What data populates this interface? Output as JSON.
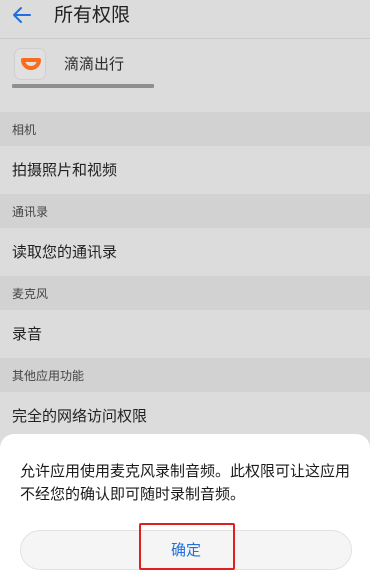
{
  "header": {
    "title": "所有权限",
    "back_icon": "back-arrow-icon"
  },
  "app": {
    "name": "滴滴出行",
    "icon": "didi-logo-icon",
    "icon_color": "#fc6a1b"
  },
  "sections": [
    {
      "heading": "相机",
      "item": "拍摄照片和视频"
    },
    {
      "heading": "通讯录",
      "item": "读取您的通讯录"
    },
    {
      "heading": "麦克风",
      "item": "录音"
    },
    {
      "heading": "其他应用功能",
      "item": "完全的网络访问权限"
    }
  ],
  "dialog": {
    "message": "允许应用使用麦克风录制音频。此权限可让这应用不经您的确认即可随时录制音频。",
    "confirm_label": "确定"
  },
  "colors": {
    "accent": "#1e6fe0",
    "highlight": "#e02020"
  }
}
